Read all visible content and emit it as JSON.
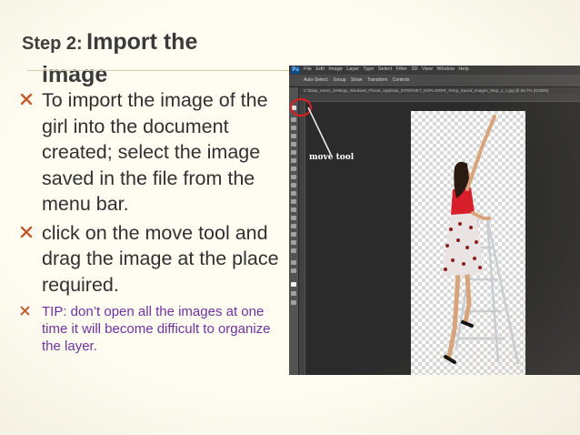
{
  "slide": {
    "title_step": "Step 2:",
    "title_main": "Import the",
    "title_main_line2": "image",
    "bullets": [
      "To import the image of the girl into the document created; select the image saved in the file from the menu bar.",
      "click on the move tool and drag the image at the place required."
    ],
    "tip": "TIP: don’t open all the images at one time it will become difficult to organize the layer.",
    "colors": {
      "title": "#3a3a3a",
      "body": "#303030",
      "tip": "#7030a0",
      "bullet_marker": "#c2592b",
      "callout_circle": "#e21d1d"
    }
  },
  "screenshot": {
    "app_logo": "Ps",
    "menu_items": "File Edit Image Layer Type Select Filter 3D View Window Help",
    "options_text": "Auto-Select: Group Show Transform Controls",
    "tab_label": "C:\\Data_Users_Settings_Windows_Phone_AppData_INTERNET_EXPLORER_Temp_Saved_Images_Step_2_1.jpg @ 66.7% (RGB/8)",
    "callout_label": "move tool",
    "icons": [
      "move-tool-icon",
      "marquee-icon",
      "lasso-icon",
      "crop-icon",
      "brush-icon",
      "eraser-icon",
      "type-icon",
      "hand-icon",
      "zoom-icon"
    ]
  }
}
